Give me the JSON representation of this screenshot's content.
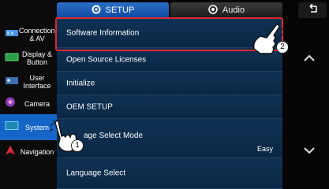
{
  "tabs": {
    "setup_label": "SETUP",
    "audio_label": "Audio",
    "setup_icon": "gear-icon",
    "audio_icon": "speaker-icon"
  },
  "sidebar": {
    "items": [
      {
        "label": "Connections & AV",
        "icon": "connections-icon"
      },
      {
        "label": "Display & Button",
        "icon": "display-icon"
      },
      {
        "label": "User Interface",
        "icon": "user-interface-icon"
      },
      {
        "label": "Camera",
        "icon": "camera-icon"
      },
      {
        "label": "System",
        "icon": "system-icon",
        "active": true
      },
      {
        "label": "Navigation",
        "icon": "navigation-icon"
      }
    ]
  },
  "menu": {
    "items": [
      {
        "label": "Software Information",
        "value": ""
      },
      {
        "label": "Open Source Licenses",
        "value": ""
      },
      {
        "label": "Initialize",
        "value": ""
      },
      {
        "label": "OEM SETUP",
        "value": ""
      },
      {
        "label": "age Select Mode",
        "value": "Easy"
      },
      {
        "label": "Language Select",
        "value": ""
      }
    ]
  },
  "callouts": {
    "step1": "1",
    "step2": "2"
  },
  "colors": {
    "accent": "#1565c7",
    "highlight": "#e0262e"
  }
}
